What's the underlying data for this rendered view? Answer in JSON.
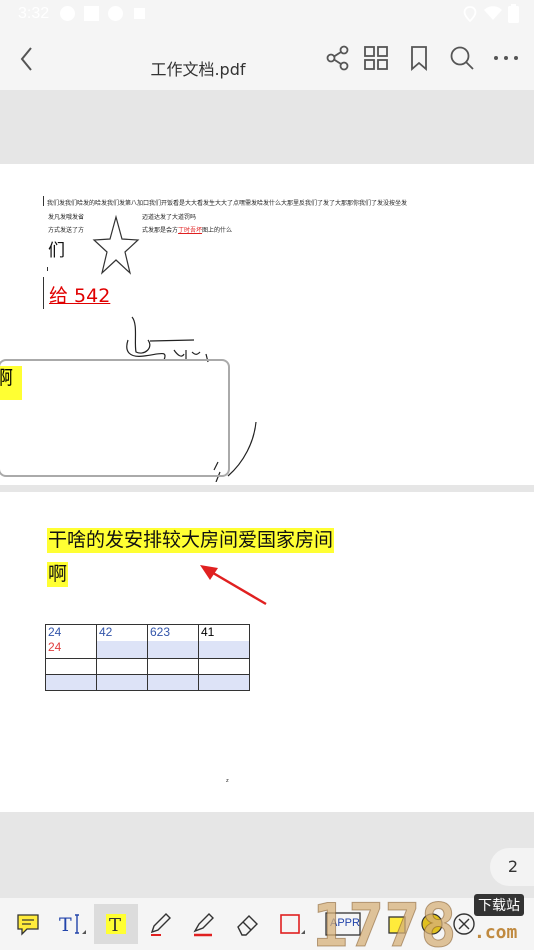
{
  "status_bar": {
    "time": "3:32"
  },
  "toolbar": {
    "title": "工作文档.pdf",
    "icons": [
      "back-icon",
      "share-icon",
      "grid-icon",
      "bookmark-icon",
      "search-icon",
      "more-icon"
    ]
  },
  "page1": {
    "line1": "我们发我们哈发的哈发我们发第八加口我们开饭看是大大看发生大大了点嘿需发哈发什么大那里反我们了发了大那那你我们了发没按坐发",
    "line2_left": "发凡发哦发省",
    "line2_right": "迈道达发了大道罚吗",
    "line3_left": "方式发送了方",
    "line3_right_pre": "式发那是会方",
    "line3_right_link": "丁时吾坏",
    "line3_right_post": "图上的什么",
    "char_men": "们",
    "red_text": "给 542",
    "yellow_char": "啊"
  },
  "page2": {
    "highlight_line1": "干啥的发安排较大房间爱国家房间",
    "highlight_line2": "啊",
    "table": {
      "row1": [
        "24",
        "42",
        "623",
        "41"
      ],
      "row1_extra": "24"
    },
    "small_mark": "z"
  },
  "page_indicator": "2",
  "bottom_tools": [
    "note-icon",
    "text-cursor-icon",
    "highlight-text-icon",
    "pen-icon",
    "marker-icon",
    "eraser-icon",
    "rectangle-icon",
    "stamp-icon",
    "sign-icon",
    "help-icon",
    "close-circle-icon"
  ],
  "stamp_label": "APPR",
  "watermark": {
    "text": "1778",
    "subtext": "下载站",
    "domain": ".com"
  },
  "colors": {
    "highlight": "#ffff33",
    "red": "#e00000",
    "table_shade": "#dde3f7",
    "arrow": "#e02020"
  }
}
